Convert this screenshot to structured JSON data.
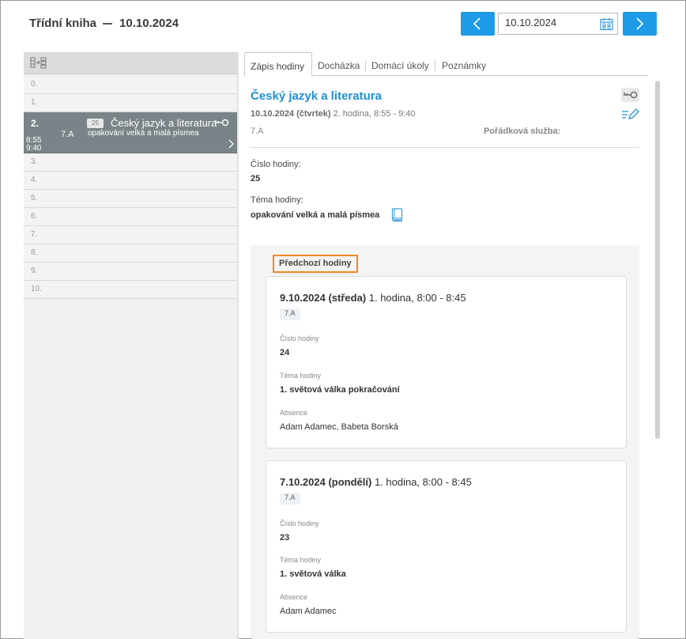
{
  "header": {
    "title": "Třídní kniha",
    "date": "10.10.2024",
    "date_input_value": "10.10.2024"
  },
  "lessons": [
    {
      "num": "0."
    },
    {
      "num": "1."
    },
    {
      "num": "2.",
      "time_from": "8:55",
      "time_to": "9:40",
      "class": "7.A",
      "badge": "25",
      "subject": "Český jazyk a literatura",
      "topic": "opakování velká a malá písmea"
    },
    {
      "num": "3."
    },
    {
      "num": "4."
    },
    {
      "num": "5."
    },
    {
      "num": "6."
    },
    {
      "num": "7."
    },
    {
      "num": "8."
    },
    {
      "num": "9."
    },
    {
      "num": "10."
    }
  ],
  "tabs": [
    "Zápis hodiny",
    "Docházka",
    "Domácí úkoly",
    "Poznámky"
  ],
  "detail": {
    "subject": "Český jazyk a literatura",
    "date_bold": "10.10.2024 (čtvrtek)",
    "date_rest": " 2. hodina, 8:55 - 9:40",
    "class": "7.A",
    "duty_label": "Pořádková služba:",
    "lesson_number_label": "Číslo hodiny:",
    "lesson_number": "25",
    "topic_label": "Téma hodiny:",
    "topic": "opakování velká a malá písmea"
  },
  "previous": {
    "title": "Předchozí hodiny",
    "cards": [
      {
        "date_bold": "9.10.2024 (středa)",
        "date_rest": " 1. hodina, 8:00 - 8:45",
        "class": "7.A",
        "number_label": "Číslo hodiny",
        "number": "24",
        "topic_label": "Téma hodiny",
        "topic": "1. světová válka pokračování",
        "absence_label": "Absence",
        "absence": "Adam Adamec, Babeta Borská"
      },
      {
        "date_bold": "7.10.2024 (pondělí)",
        "date_rest": " 1. hodina, 8:00 - 8:45",
        "class": "7.A",
        "number_label": "Číslo hodiny",
        "number": "23",
        "topic_label": "Téma hodiny",
        "topic": "1. světová válka",
        "absence_label": "Absence",
        "absence": "Adam Adamec"
      }
    ]
  },
  "colors": {
    "accent": "#1e9be6",
    "active_lesson": "#7a8488",
    "highlight_border": "#f08a24"
  }
}
